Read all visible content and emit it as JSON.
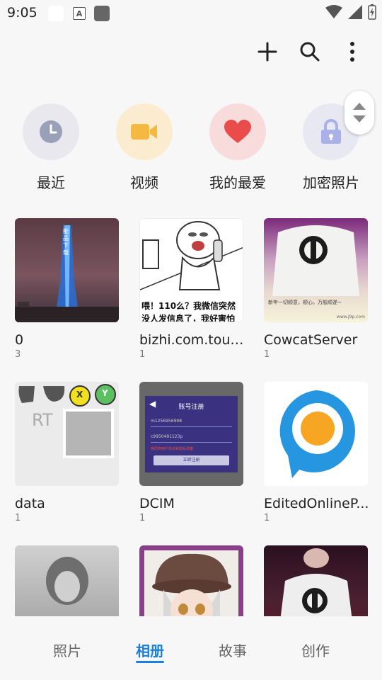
{
  "status_bar": {
    "time": "9:05",
    "notif_icon_letter": "A"
  },
  "toolbar": {
    "icons": [
      "plus-icon",
      "search-icon",
      "more-vert-icon"
    ]
  },
  "categories": [
    {
      "label": "最近",
      "icon": "clock-icon",
      "bg": "#e8e8ee",
      "fg": "#9aa0b8"
    },
    {
      "label": "视频",
      "icon": "video-icon",
      "bg": "#fbeccf",
      "fg": "#f5b942"
    },
    {
      "label": "我的最爱",
      "icon": "heart-icon",
      "bg": "#f8dcdc",
      "fg": "#ea4c4c"
    },
    {
      "label": "加密照片",
      "icon": "lock-icon",
      "bg": "#e8e8f3",
      "fg": "#aab0e8"
    }
  ],
  "albums": [
    {
      "name": "0",
      "count": "3"
    },
    {
      "name": "bizhi.com.touxi...",
      "count": "1"
    },
    {
      "name": "CowcatServer",
      "count": "1"
    },
    {
      "name": "data",
      "count": "1"
    },
    {
      "name": "DCIM",
      "count": "1"
    },
    {
      "name": "EditedOnlineP...",
      "count": "1"
    },
    {
      "name": "",
      "count": ""
    },
    {
      "name": "",
      "count": ""
    },
    {
      "name": "",
      "count": ""
    }
  ],
  "thumb_text": {
    "tower_sign": "能品下载",
    "meme_caption_1": "喂！110么？我微信突然",
    "meme_caption_2": "没人发信息了，我好害怕",
    "cowcat_caption": "新年一切顺意，顺心，万般顺遂~",
    "cowcat_site": "www.j9p.com",
    "data_letters": "RT",
    "data_x": "X",
    "data_y": "Y",
    "dcim_title": "账号注册",
    "dcim_phone": "m1256956998",
    "dcim_pass": "c9950491123p",
    "dcim_agree": "我同意用户协议和隐私政策",
    "dcim_button": "立即注册"
  },
  "bottom_nav": {
    "tabs": [
      {
        "label": "照片",
        "active": false
      },
      {
        "label": "相册",
        "active": true
      },
      {
        "label": "故事",
        "active": false
      },
      {
        "label": "创作",
        "active": false
      }
    ],
    "accent": "#1a7fe0"
  }
}
